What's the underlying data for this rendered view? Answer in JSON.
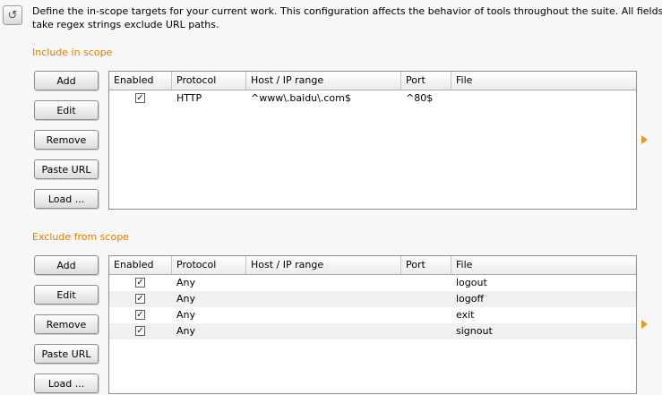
{
  "description": "Define the in-scope targets for your current work. This configuration affects the behavior of tools throughout the suite. All fields take regex strings exclude URL paths.",
  "columns": [
    "Enabled",
    "Protocol",
    "Host / IP range",
    "Port",
    "File"
  ],
  "buttons": [
    "Add",
    "Edit",
    "Remove",
    "Paste URL",
    "Load ..."
  ],
  "include": {
    "title": "Include in scope",
    "rows": [
      {
        "enabled": true,
        "protocol": "HTTP",
        "host": "^www\\.baidu\\.com$",
        "port": "^80$",
        "file": ""
      }
    ]
  },
  "exclude": {
    "title": "Exclude from scope",
    "rows": [
      {
        "enabled": true,
        "protocol": "Any",
        "host": "",
        "port": "",
        "file": "logout"
      },
      {
        "enabled": true,
        "protocol": "Any",
        "host": "",
        "port": "",
        "file": "logoff"
      },
      {
        "enabled": true,
        "protocol": "Any",
        "host": "",
        "port": "",
        "file": "exit"
      },
      {
        "enabled": true,
        "protocol": "Any",
        "host": "",
        "port": "",
        "file": "signout"
      }
    ]
  },
  "colors": {
    "section_title": "#e07b00",
    "arrow": "#e49a1a"
  }
}
